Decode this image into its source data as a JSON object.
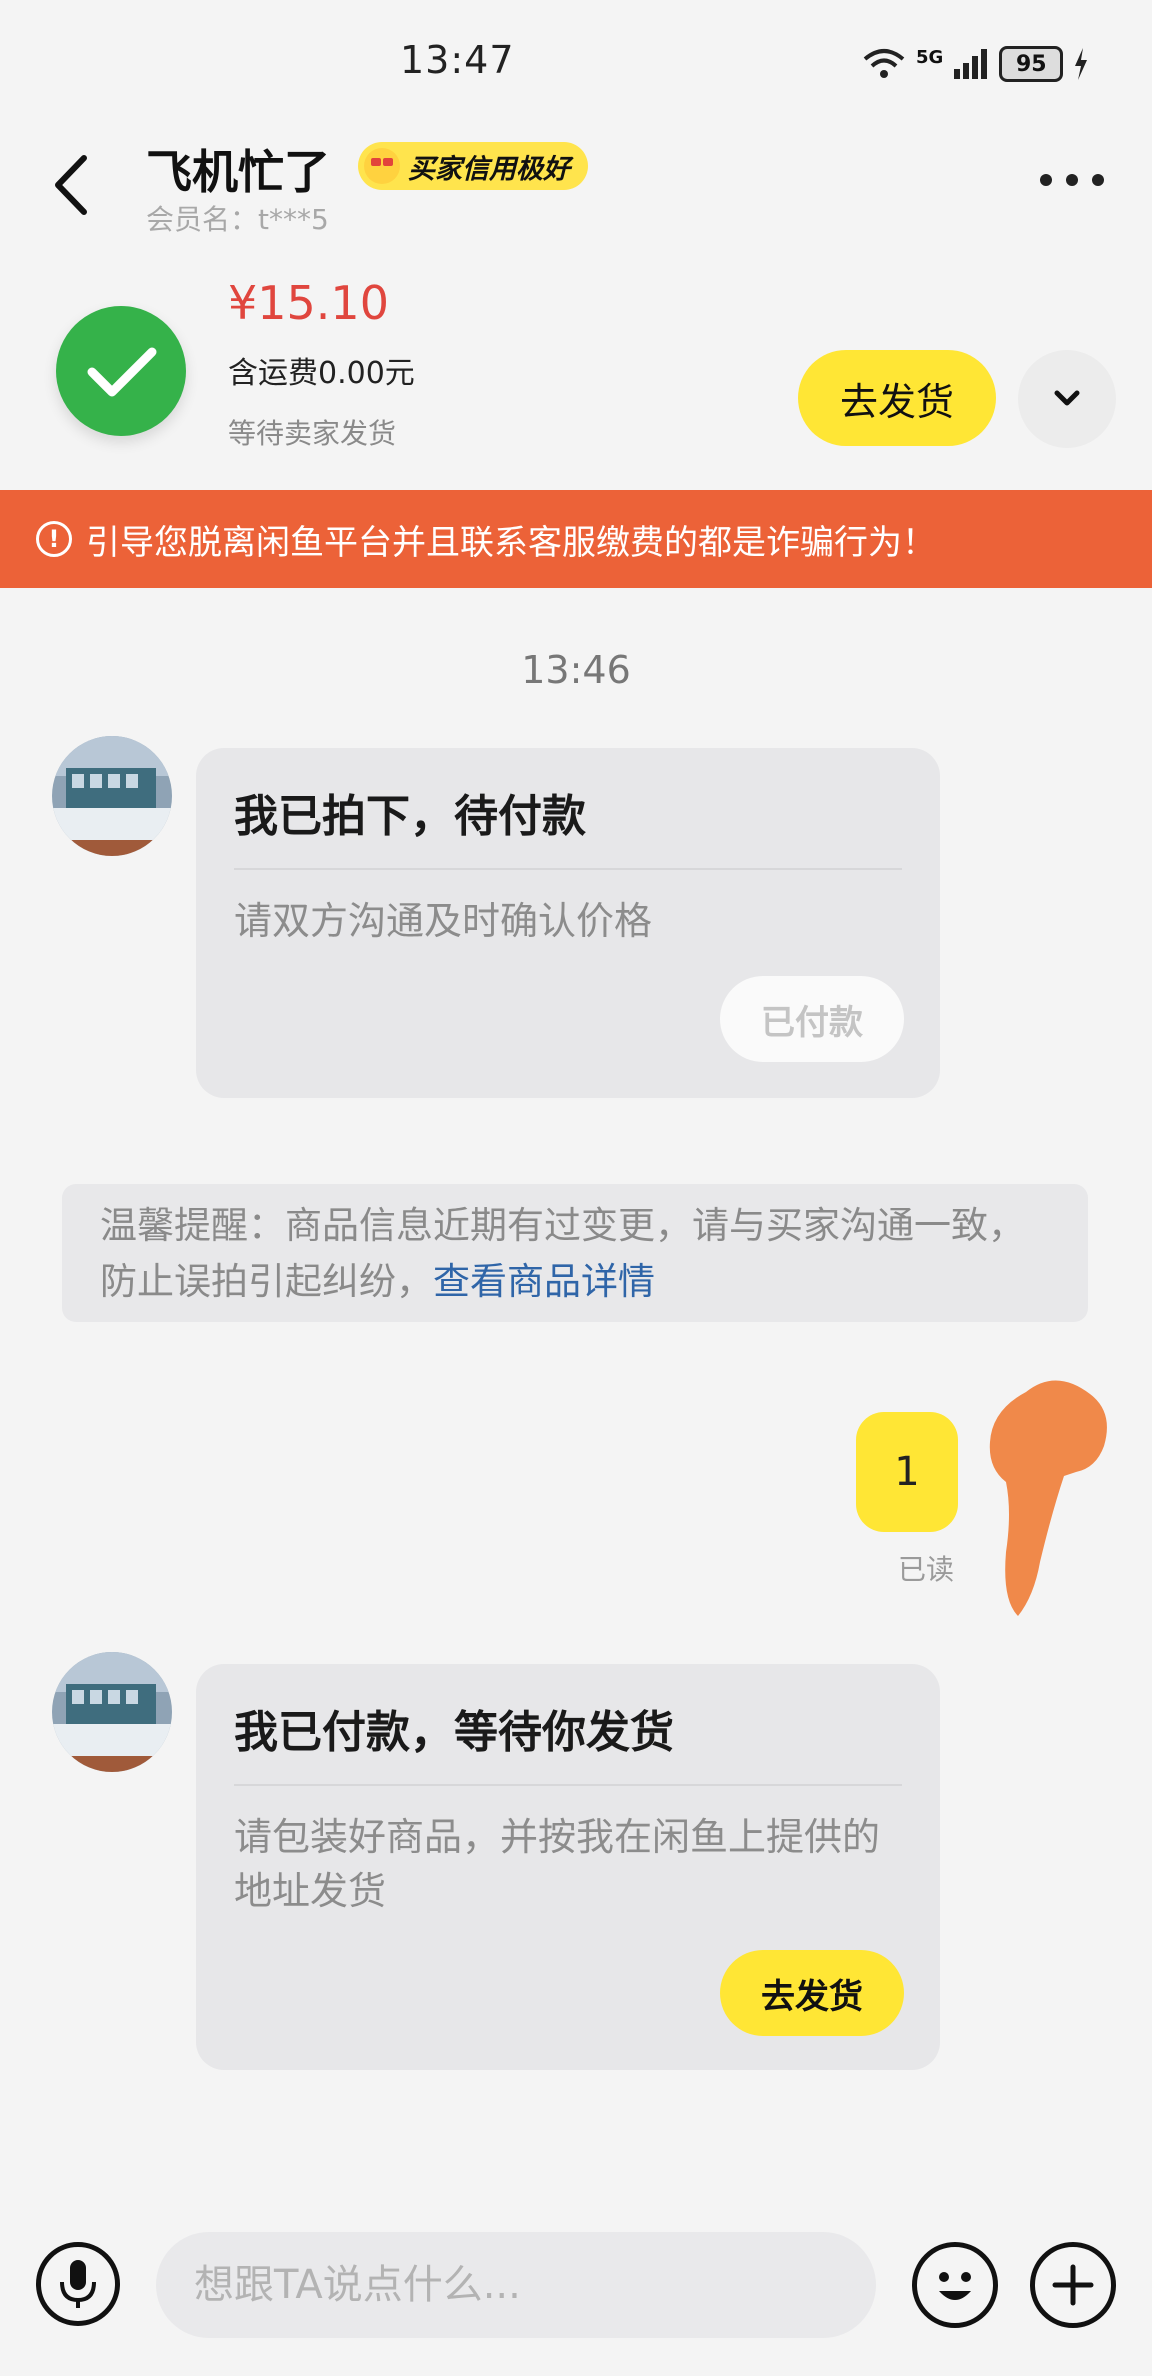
{
  "status_bar": {
    "time": "13:47",
    "network": "5G",
    "battery": "95"
  },
  "header": {
    "nickname": "飞机忙了",
    "credit_badge": "买家信用极好",
    "member_label": "会员名：t***5"
  },
  "order": {
    "price": "¥15.10",
    "shipping": "含运费0.00元",
    "status": "等待卖家发货",
    "ship_button": "去发货"
  },
  "warning": {
    "icon": "!",
    "text": "引导您脱离闲鱼平台并且联系客服缴费的都是诈骗行为！"
  },
  "chat": {
    "timestamp": "13:46",
    "card1": {
      "title": "我已拍下，待付款",
      "desc": "请双方沟通及时确认价格",
      "button": "已付款"
    },
    "notice": {
      "text": "温馨提醒：商品信息近期有过变更，请与买家沟通一致，防止误拍引起纠纷，",
      "link": "查看商品详情"
    },
    "my_message": {
      "text": "1",
      "read": "已读"
    },
    "card2": {
      "title": "我已付款，等待你发货",
      "desc": "请包装好商品，并按我在闲鱼上提供的地址发货",
      "button": "去发货"
    }
  },
  "input_bar": {
    "placeholder": "想跟TA说点什么..."
  },
  "colors": {
    "brand_yellow": "#ffe635",
    "warning_orange": "#ec6238",
    "price_red": "#e0463e",
    "success_green": "#35b24a",
    "link_blue": "#2f65a8"
  }
}
